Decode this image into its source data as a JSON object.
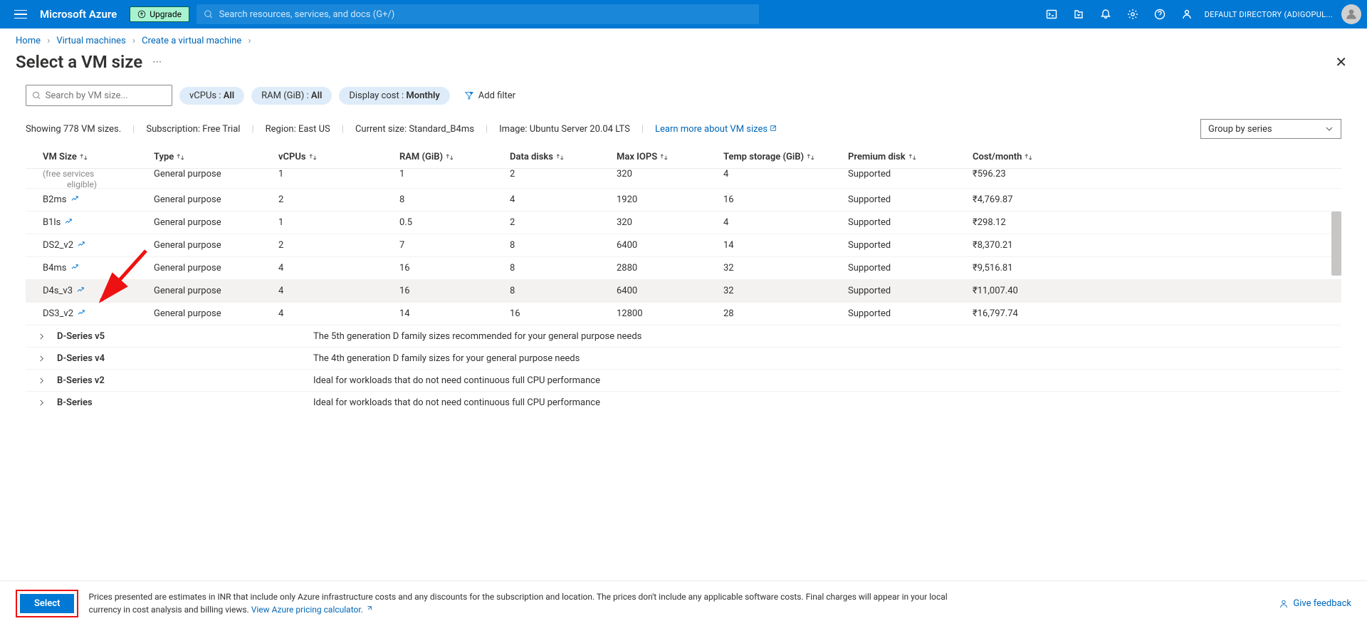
{
  "header": {
    "brand": "Microsoft Azure",
    "upgrade": "Upgrade",
    "search_placeholder": "Search resources, services, and docs (G+/)",
    "tenant": "DEFAULT DIRECTORY (ADIGOPUL..."
  },
  "breadcrumb": {
    "home": "Home",
    "vm": "Virtual machines",
    "create": "Create a virtual machine"
  },
  "page": {
    "title": "Select a VM size"
  },
  "filters": {
    "search_placeholder": "Search by VM size...",
    "vcpus_label": "vCPUs : ",
    "vcpus_value": "All",
    "ram_label": "RAM (GiB) : ",
    "ram_value": "All",
    "cost_label": "Display cost : ",
    "cost_value": "Monthly",
    "add_filter": "Add filter"
  },
  "info": {
    "showing": "Showing 778 VM sizes.",
    "subscription": "Subscription: Free Trial",
    "region": "Region: East US",
    "current": "Current size: Standard_B4ms",
    "image": "Image: Ubuntu Server 20.04 LTS",
    "learn": "Learn more about VM sizes",
    "groupby": "Group by series"
  },
  "columns": {
    "c0": "VM Size",
    "c1": "Type",
    "c2": "vCPUs",
    "c3": "RAM (GiB)",
    "c4": "Data disks",
    "c5": "Max IOPS",
    "c6": "Temp storage (GiB)",
    "c7": "Premium disk",
    "c8": "Cost/month"
  },
  "rows": [
    {
      "name": "",
      "partial": "(free services",
      "eligible": "eligible)",
      "type": "General purpose",
      "vcpus": "1",
      "ram": "1",
      "disks": "2",
      "iops": "320",
      "temp": "4",
      "premium": "Supported",
      "cost": "₹596.23"
    },
    {
      "name": "B2ms",
      "type": "General purpose",
      "vcpus": "2",
      "ram": "8",
      "disks": "4",
      "iops": "1920",
      "temp": "16",
      "premium": "Supported",
      "cost": "₹4,769.87"
    },
    {
      "name": "B1ls",
      "type": "General purpose",
      "vcpus": "1",
      "ram": "0.5",
      "disks": "2",
      "iops": "320",
      "temp": "4",
      "premium": "Supported",
      "cost": "₹298.12"
    },
    {
      "name": "DS2_v2",
      "type": "General purpose",
      "vcpus": "2",
      "ram": "7",
      "disks": "8",
      "iops": "6400",
      "temp": "14",
      "premium": "Supported",
      "cost": "₹8,370.21"
    },
    {
      "name": "B4ms",
      "type": "General purpose",
      "vcpus": "4",
      "ram": "16",
      "disks": "8",
      "iops": "2880",
      "temp": "32",
      "premium": "Supported",
      "cost": "₹9,516.81"
    },
    {
      "name": "D4s_v3",
      "type": "General purpose",
      "vcpus": "4",
      "ram": "16",
      "disks": "8",
      "iops": "6400",
      "temp": "32",
      "premium": "Supported",
      "cost": "₹11,007.40",
      "hl": true
    },
    {
      "name": "DS3_v2",
      "type": "General purpose",
      "vcpus": "4",
      "ram": "14",
      "disks": "16",
      "iops": "12800",
      "temp": "28",
      "premium": "Supported",
      "cost": "₹16,797.74"
    }
  ],
  "groups": [
    {
      "name": "D-Series v5",
      "desc": "The 5th generation D family sizes recommended for your general purpose needs"
    },
    {
      "name": "D-Series v4",
      "desc": "The 4th generation D family sizes for your general purpose needs"
    },
    {
      "name": "B-Series v2",
      "desc": "Ideal for workloads that do not need continuous full CPU performance"
    },
    {
      "name": "B-Series",
      "desc": "Ideal for workloads that do not need continuous full CPU performance"
    }
  ],
  "footer": {
    "select": "Select",
    "note": "Prices presented are estimates in INR that include only Azure infrastructure costs and any discounts for the subscription and location. The prices don't include any applicable software costs. Final charges will appear in your local currency in cost analysis and billing views. ",
    "calc": "View Azure pricing calculator.",
    "feedback": "Give feedback"
  }
}
